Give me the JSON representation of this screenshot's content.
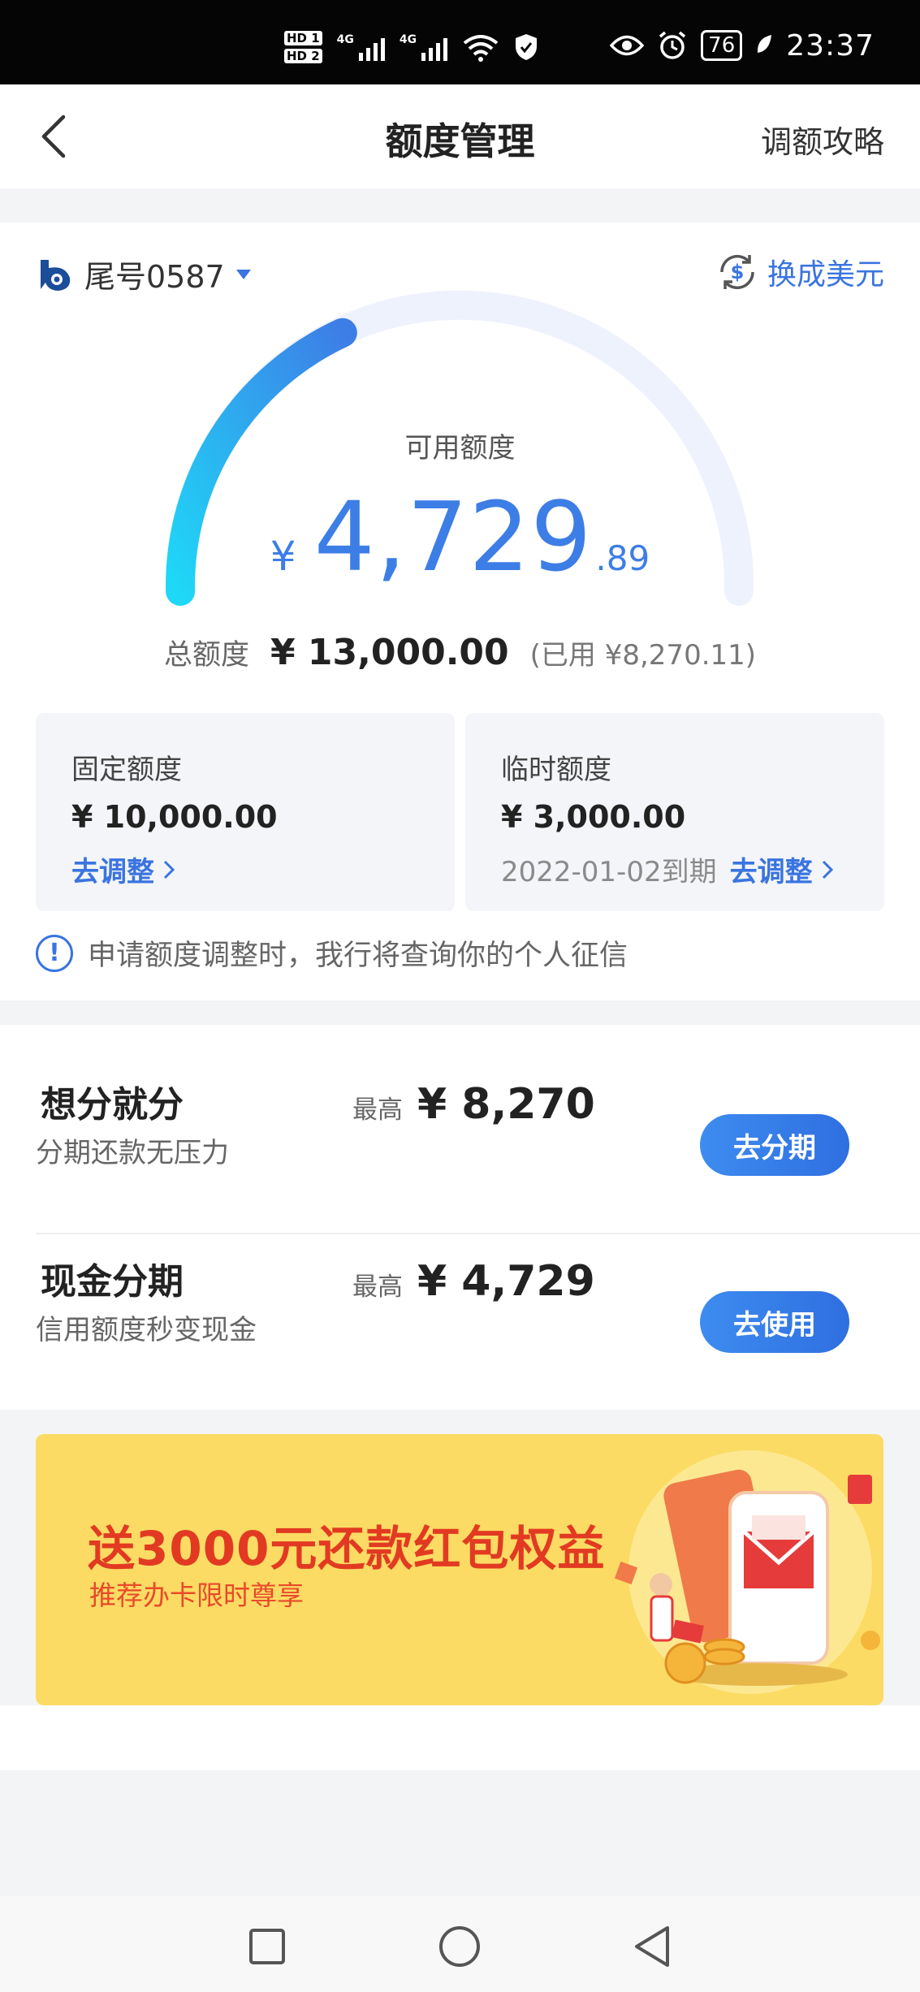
{
  "status_bar": {
    "hd1": "HD 1",
    "hd2": "HD 2",
    "net1": "4G",
    "net2": "4G",
    "wifi_tag": "6",
    "battery": "76",
    "time": "23:37"
  },
  "header": {
    "title": "额度管理",
    "right_link": "调额攻略"
  },
  "card": {
    "selector": "尾号0587",
    "currency_switch": "换成美元"
  },
  "credit": {
    "available_label": "可用额度",
    "available_currency": "¥",
    "available_int": "4,729",
    "available_dec": ".89",
    "available_fraction": 0.3638,
    "total_label": "总额度",
    "total_value": "¥ 13,000.00",
    "used_text": "(已用 ¥8,270.11)"
  },
  "fixed": {
    "label": "固定额度",
    "value": "¥ 10,000.00",
    "action": "去调整"
  },
  "temporary": {
    "label": "临时额度",
    "value": "¥ 3,000.00",
    "expire": "2022-01-02到期",
    "action": "去调整"
  },
  "notice": "申请额度调整时，我行将查询你的个人征信",
  "installments": [
    {
      "title": "想分就分",
      "subtitle": "分期还款无压力",
      "max_label": "最高",
      "max_value": "¥ 8,270",
      "button": "去分期"
    },
    {
      "title": "现金分期",
      "subtitle": "信用额度秒变现金",
      "max_label": "最高",
      "max_value": "¥ 4,729",
      "button": "去使用"
    }
  ],
  "banner": {
    "title": "送3000元还款红包权益",
    "subtitle": "推荐办卡限时尊享"
  },
  "colors": {
    "accent": "#3a74e0",
    "gauge_start": "#1fd7f7",
    "gauge_end": "#3d7ee6",
    "gauge_track": "#eef2fc",
    "banner_bg": "#fbdb63",
    "banner_text": "#e23a22"
  },
  "icons": {
    "back": "chevron-left-icon",
    "bank_logo": "bank-logo-icon",
    "dropdown": "triangle-down-icon",
    "currency": "dollar-exchange-icon",
    "info": "info-circle-icon"
  }
}
